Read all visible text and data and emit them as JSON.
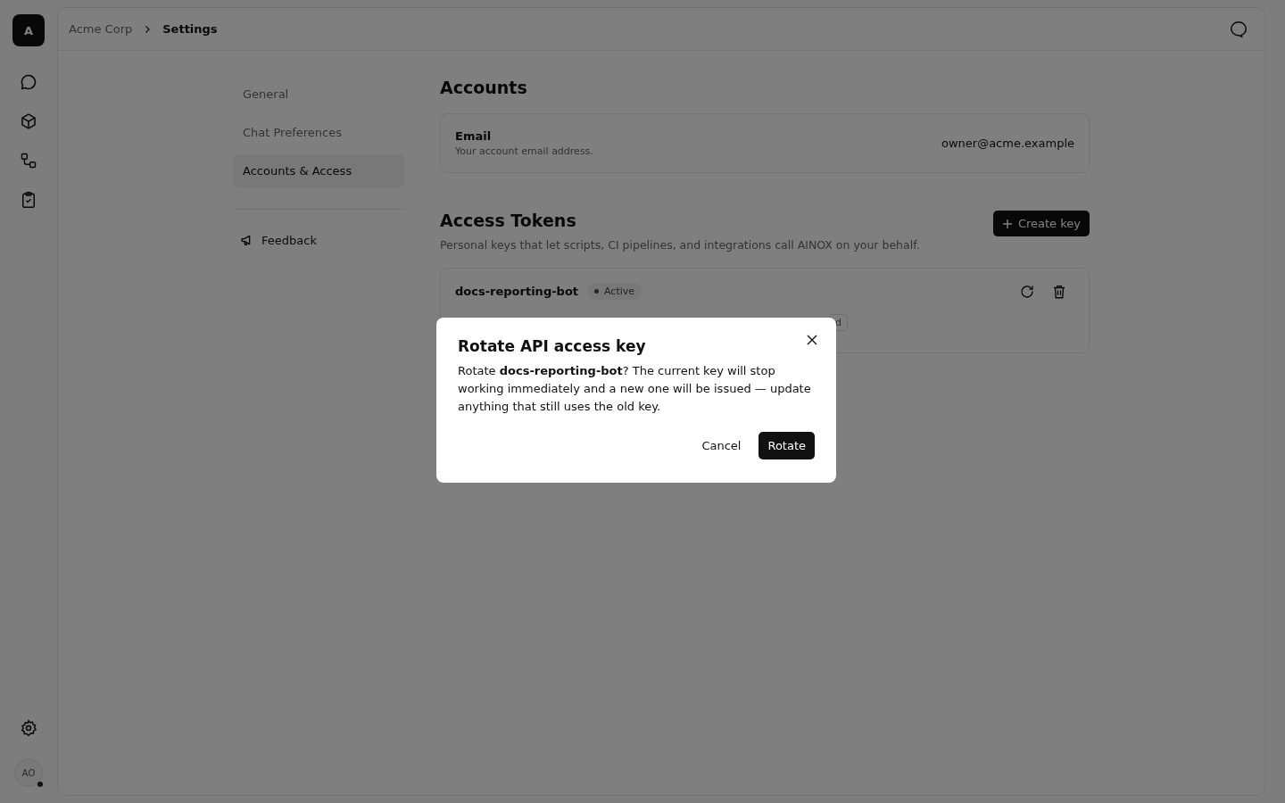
{
  "rail": {
    "logo": "A",
    "avatar": "AO"
  },
  "breadcrumb": [
    {
      "label": "Acme Corp",
      "current": false
    },
    {
      "label": "Settings",
      "current": true
    }
  ],
  "settings_nav": {
    "items": [
      {
        "label": "General",
        "selected": false
      },
      {
        "label": "Chat Preferences",
        "selected": false
      },
      {
        "label": "Accounts & Access",
        "selected": true
      }
    ],
    "feedback": "Feedback"
  },
  "accounts": {
    "title": "Accounts",
    "email_label": "Email",
    "email_hint": "Your account email address.",
    "email_value": "owner@acme.example"
  },
  "access_tokens": {
    "title": "Access Tokens",
    "description": "Personal keys that let scripts, CI pipelines, and integrations call AINOX on your behalf.",
    "create_button": "Create key",
    "keys": [
      {
        "name": "docs-reporting-bot",
        "status": "Active",
        "badge_fragment": "d"
      }
    ]
  },
  "dialog": {
    "title": "Rotate API access key",
    "body": "Rotate **docs-reporting-bot**? The current key will stop working immediately and a new one will be issued — update anything that still uses the old key.",
    "cancel": "Cancel",
    "confirm": "Rotate"
  }
}
